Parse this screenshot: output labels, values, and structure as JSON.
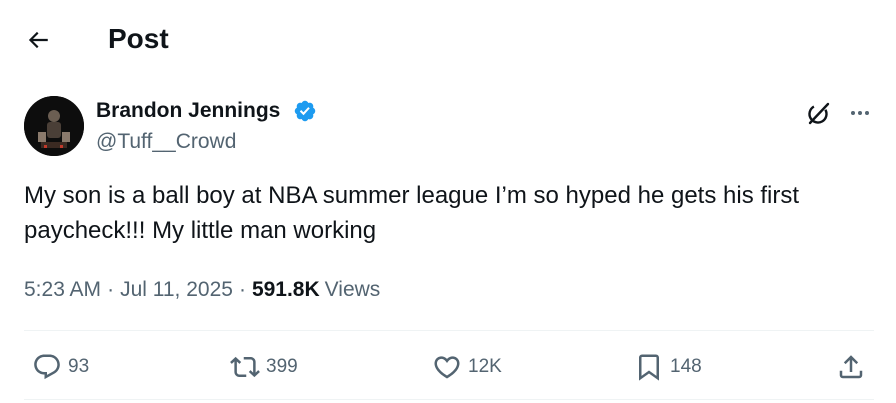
{
  "header": {
    "back_icon": "arrow-left-icon",
    "title": "Post"
  },
  "author": {
    "name": "Brandon Jennings",
    "handle": "@Tuff__Crowd",
    "verified_icon": "verified-badge-icon",
    "verified_color": "#1d9bf0"
  },
  "post": {
    "text": "My son is a ball boy at NBA summer league I’m so hyped he gets his first paycheck!!! My little man working",
    "time": "5:23 AM",
    "date": "Jul 11, 2025",
    "separator": "·",
    "views_count": "591.8K",
    "views_label": "Views"
  },
  "actions": {
    "replies": "93",
    "reposts": "399",
    "likes": "12K",
    "bookmarks": "148"
  },
  "colors": {
    "text_primary": "#0f1419",
    "text_secondary": "#536471",
    "divider": "#eff3f4"
  }
}
